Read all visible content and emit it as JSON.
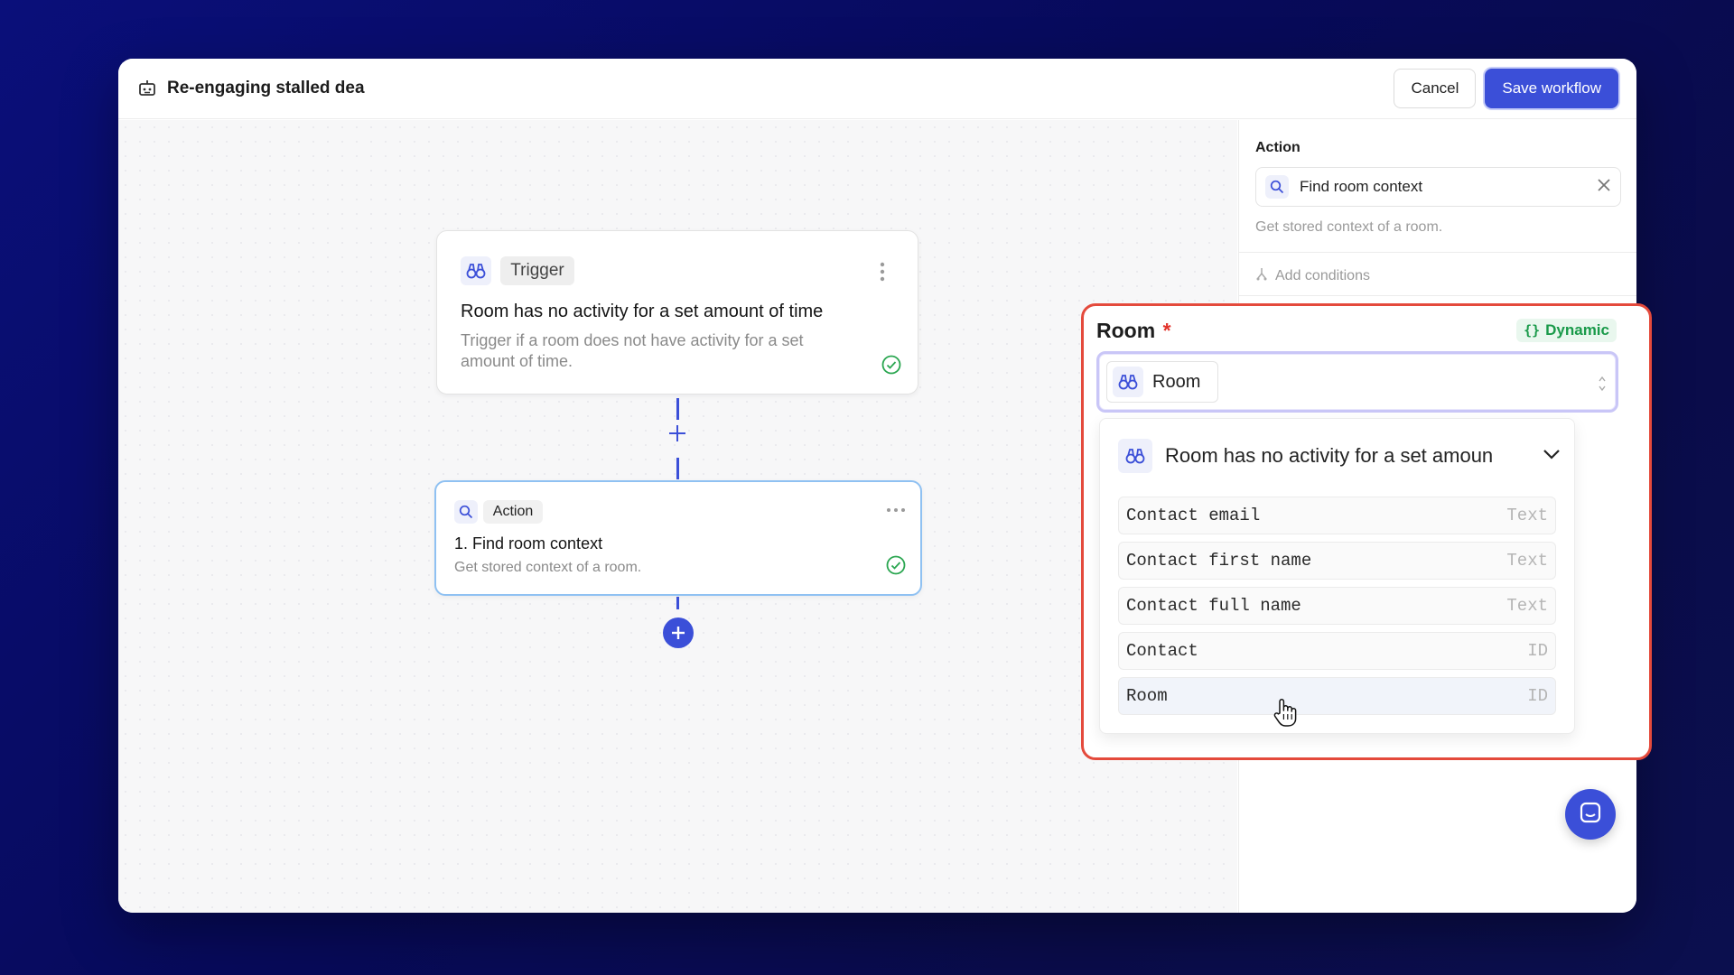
{
  "header": {
    "title": "Re-engaging stalled dea",
    "title_icon": "robot-icon",
    "cancel_label": "Cancel",
    "save_label": "Save workflow"
  },
  "trigger_node": {
    "chip_label": "Trigger",
    "icon": "binoculars-icon",
    "heading": "Room has no activity for a set amount of time",
    "description": "Trigger if a room does not have activity for a set amount of time.",
    "status_icon": "check-circle-icon"
  },
  "action_node": {
    "chip_label": "Action",
    "icon": "search-icon",
    "heading": "1. Find room context",
    "description": "Get stored context of a room.",
    "status_icon": "check-circle-icon"
  },
  "side_panel": {
    "section_label": "Action",
    "selected_action": "Find room context",
    "action_description": "Get stored context of a room.",
    "add_conditions_label": "Add conditions"
  },
  "room_field": {
    "label": "Room",
    "required_mark": "*",
    "dynamic_label": "Dynamic",
    "selected_value": "Room",
    "dropdown_group": "Room has no activity for a set amoun",
    "options": [
      {
        "label": "Contact email",
        "type": "Text"
      },
      {
        "label": "Contact first name",
        "type": "Text"
      },
      {
        "label": "Contact full name",
        "type": "Text"
      },
      {
        "label": "Contact",
        "type": "ID"
      },
      {
        "label": "Room",
        "type": "ID"
      }
    ]
  },
  "colors": {
    "accent": "#3b4fd8",
    "highlight": "#e44a3c",
    "success": "#1a9a4a"
  }
}
